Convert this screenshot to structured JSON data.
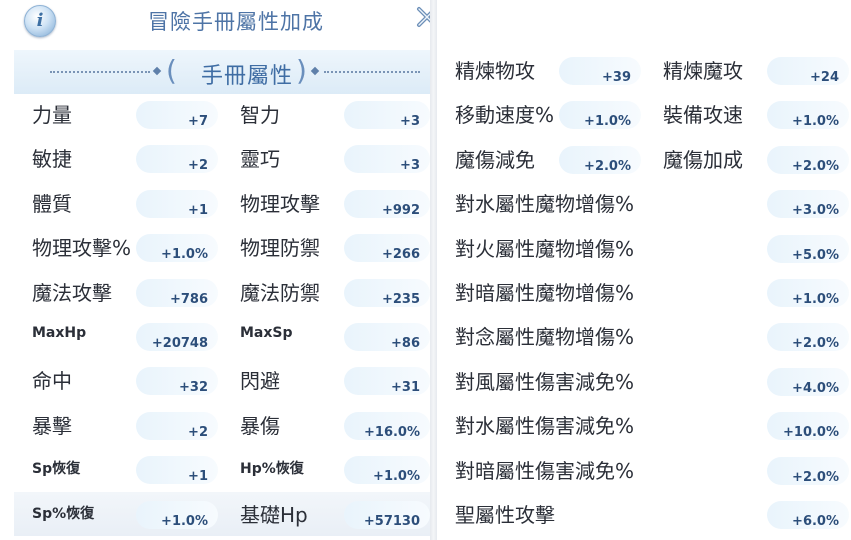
{
  "header": {
    "title": "冒險手冊屬性加成",
    "info_icon": "info-icon",
    "close_icon": "close-icon"
  },
  "banner": {
    "title": "手冊屬性",
    "open_paren": "(",
    "close_paren": ")"
  },
  "left_rows": [
    {
      "a_label": "力量",
      "a_value": "+7",
      "b_label": "智力",
      "b_value": "+3"
    },
    {
      "a_label": "敏捷",
      "a_value": "+2",
      "b_label": "靈巧",
      "b_value": "+3"
    },
    {
      "a_label": "體質",
      "a_value": "+1",
      "b_label": "物理攻擊",
      "b_value": "+992"
    },
    {
      "a_label": "物理攻擊%",
      "a_value": "+1.0%",
      "b_label": "物理防禦",
      "b_value": "+266"
    },
    {
      "a_label": "魔法攻擊",
      "a_value": "+786",
      "b_label": "魔法防禦",
      "b_value": "+235"
    },
    {
      "a_label": "MaxHp",
      "a_value": "+20748",
      "b_label": "MaxSp",
      "b_value": "+86"
    },
    {
      "a_label": "命中",
      "a_value": "+32",
      "b_label": "閃避",
      "b_value": "+31"
    },
    {
      "a_label": "暴擊",
      "a_value": "+2",
      "b_label": "暴傷",
      "b_value": "+16.0%"
    },
    {
      "a_label": "Sp恢復",
      "a_value": "+1",
      "b_label": "Hp%恢復",
      "b_value": "+1.0%"
    },
    {
      "a_label": "Sp%恢復",
      "a_value": "+1.0%",
      "b_label": "基礎Hp",
      "b_value": "+57130"
    }
  ],
  "right_pairs": [
    {
      "a_label": "精煉物攻",
      "a_value": "+39",
      "b_label": "精煉魔攻",
      "b_value": "+24"
    },
    {
      "a_label": "移動速度%",
      "a_value": "+1.0%",
      "b_label": "裝備攻速",
      "b_value": "+1.0%"
    },
    {
      "a_label": "魔傷減免",
      "a_value": "+2.0%",
      "b_label": "魔傷加成",
      "b_value": "+2.0%"
    }
  ],
  "right_singles": [
    {
      "label": "對水屬性魔物增傷%",
      "value": "+3.0%"
    },
    {
      "label": "對火屬性魔物增傷%",
      "value": "+5.0%"
    },
    {
      "label": "對暗屬性魔物增傷%",
      "value": "+1.0%"
    },
    {
      "label": "對念屬性魔物增傷%",
      "value": "+2.0%"
    },
    {
      "label": "對風屬性傷害減免%",
      "value": "+4.0%"
    },
    {
      "label": "對水屬性傷害減免%",
      "value": "+10.0%"
    },
    {
      "label": "對暗屬性傷害減免%",
      "value": "+2.0%"
    },
    {
      "label": "聖屬性攻擊",
      "value": "+6.0%"
    }
  ]
}
